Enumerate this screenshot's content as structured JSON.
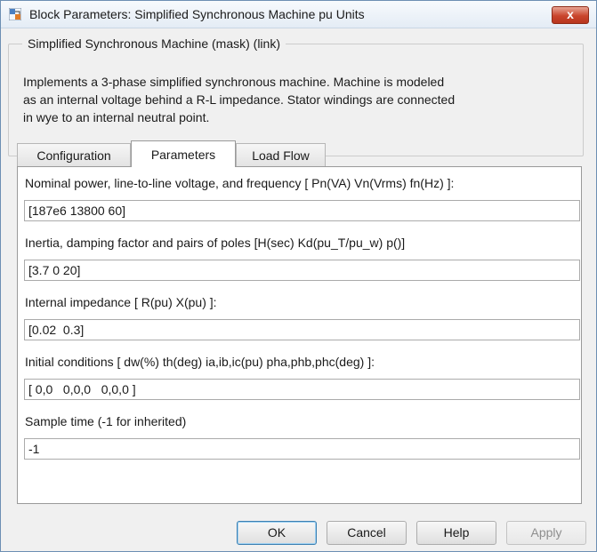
{
  "window": {
    "title": "Block Parameters: Simplified Synchronous Machine pu Units",
    "close_label": "x"
  },
  "group": {
    "title": "Simplified Synchronous Machine (mask) (link)",
    "description_lines": [
      "Implements a 3-phase simplified synchronous machine. Machine is modeled",
      "as an internal voltage behind a R-L impedance. Stator windings are connected",
      "in wye to an internal neutral point."
    ]
  },
  "tabs": [
    {
      "label": "Configuration",
      "active": false
    },
    {
      "label": "Parameters",
      "active": true
    },
    {
      "label": "Load Flow",
      "active": false
    }
  ],
  "params": [
    {
      "label": "Nominal power, line-to-line voltage, and frequency [ Pn(VA) Vn(Vrms) fn(Hz) ]:",
      "value": "[187e6 13800 60]"
    },
    {
      "label": "Inertia, damping factor and pairs of poles [H(sec) Kd(pu_T/pu_w) p()]",
      "value": "[3.7 0 20]"
    },
    {
      "label": "Internal impedance [ R(pu)  X(pu) ]:",
      "value": "[0.02  0.3]"
    },
    {
      "label": "Initial conditions [ dw(%)  th(deg)  ia,ib,ic(pu)  pha,phb,phc(deg) ]:",
      "value": "[ 0,0   0,0,0   0,0,0 ]"
    },
    {
      "label": "Sample time (-1 for inherited)",
      "value": "-1"
    }
  ],
  "buttons": {
    "ok": "OK",
    "cancel": "Cancel",
    "help": "Help",
    "apply": "Apply"
  }
}
